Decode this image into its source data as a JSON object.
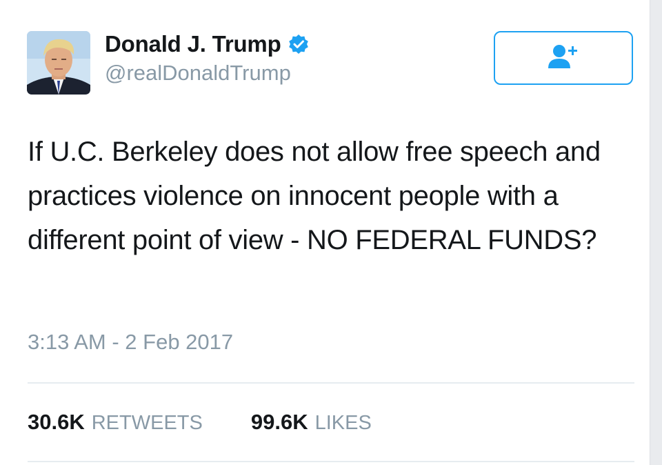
{
  "tweet": {
    "author": {
      "display_name": "Donald J. Trump",
      "handle": "@realDonaldTrump",
      "verified": true
    },
    "follow_button": {
      "icon": "add-user-icon"
    },
    "text": "If U.C. Berkeley does not allow free speech and practices violence on innocent people with a different point of view - NO FEDERAL FUNDS?",
    "timestamp": "3:13 AM - 2 Feb 2017",
    "stats": {
      "retweets_count": "30.6K",
      "retweets_label": "RETWEETS",
      "likes_count": "99.6K",
      "likes_label": "LIKES"
    }
  },
  "colors": {
    "accent": "#1da1f2",
    "verified_badge": "#1da1f2",
    "secondary_text": "#8899a6",
    "primary_text": "#14171a",
    "divider": "#e6ecf0"
  }
}
